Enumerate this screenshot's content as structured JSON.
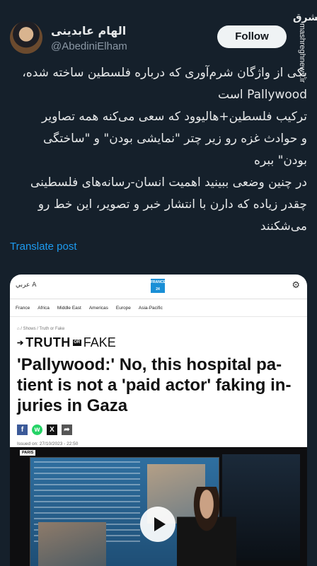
{
  "watermark": {
    "logo": "مشرق",
    "site": "mashreghnews.ir"
  },
  "author": {
    "name": "الهام عابدینی",
    "handle": "@AbediniElham"
  },
  "follow_label": "Follow",
  "post": {
    "lines": [
      "یکی از واژگان شرم‌آوری که درباره فلسطین ساخته شده،",
      "Pallywood است",
      "ترکیب فلسطین+هالیوود که سعی می‌کنه همه تصاویر",
      "و حوادث غزه رو زیر چتر \"نمایشی بودن\" و \"ساختگی",
      "بودن\" ببره",
      "در چنین وضعی ببینید اهمیت انسان-رسانه‌های فلسطینی",
      "چقدر زیاده که دارن با انتشار خبر و تصویر، این خط رو",
      "می‌شکنند"
    ]
  },
  "translate_label": "Translate post",
  "card": {
    "lang_switch": "عربي A",
    "logo_text": "FRANCE 24",
    "nav": [
      "France",
      "Africa",
      "Middle East",
      "Americas",
      "Europe",
      "Asia-Pacific"
    ],
    "breadcrumb": "⌂ / Shows / Truth or Fake",
    "truth": "TRUTH",
    "or": "OR",
    "fake": "FAKE",
    "headline": "'Pallywood:' No, this hospital pa-tient is not a 'paid actor' faking in-juries in Gaza",
    "share_icons": [
      "f",
      "w",
      "X",
      "➦"
    ],
    "issued": "Issued on: 27/10/2023 - 22:50",
    "video_tag": "PARIS"
  }
}
